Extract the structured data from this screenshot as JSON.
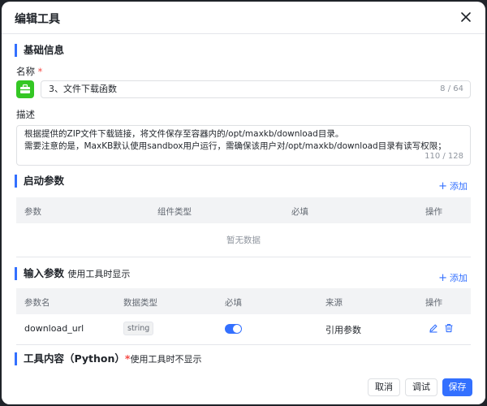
{
  "dialog": {
    "title": "编辑工具",
    "close_icon": "close-icon"
  },
  "basic": {
    "section_title": "基础信息",
    "name_label": "名称",
    "required_mark": "*",
    "tool_icon": "toolbox-icon",
    "name_value": "3、文件下载函数",
    "name_counter": "8 / 64",
    "desc_label": "描述",
    "desc_line1": "根据提供的ZIP文件下载链接，将文件保存至容器内的/opt/maxkb/download目录。",
    "desc_line2": "需要注意的是，MaxKB默认使用sandbox用户运行，需确保该用户对/opt/maxkb/download目录有读写权限；",
    "desc_counter": "110 / 128"
  },
  "startup": {
    "section_title": "启动参数",
    "add_label": "添加",
    "columns": [
      "参数",
      "组件类型",
      "必填",
      "操作"
    ],
    "empty_text": "暂无数据"
  },
  "input_params": {
    "section_title": "输入参数",
    "section_sub": "使用工具时显示",
    "add_label": "添加",
    "columns": [
      "参数名",
      "数据类型",
      "必填",
      "来源",
      "操作"
    ],
    "rows": [
      {
        "name": "download_url",
        "type": "string",
        "required": true,
        "source": "引用参数"
      }
    ]
  },
  "content": {
    "section_title": "工具内容（Python）",
    "required_mark": "*",
    "section_sub": "使用工具时不显示"
  },
  "footer": {
    "cancel_label": "取消",
    "debug_label": "调试",
    "save_label": "保存"
  },
  "colors": {
    "accent": "#3370ff",
    "tool_icon_bg": "#34c724",
    "required": "#f54a45"
  }
}
